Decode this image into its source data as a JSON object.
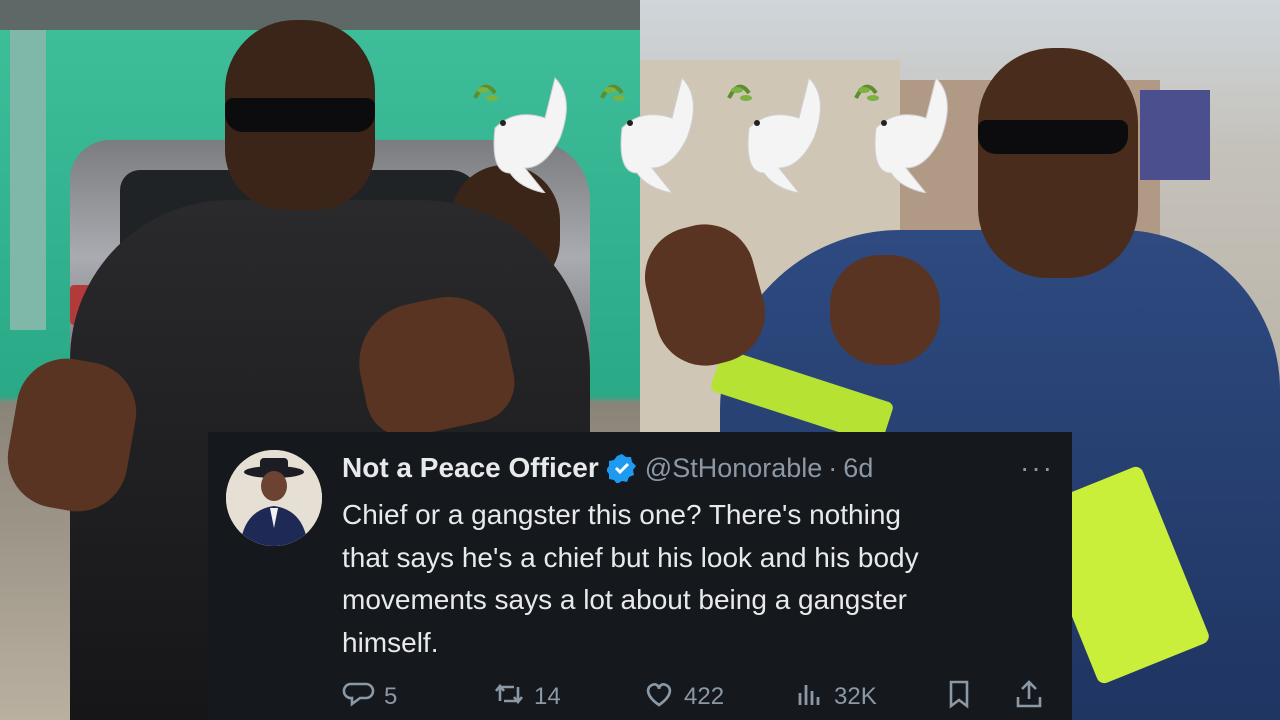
{
  "tweet": {
    "display_name": "Not a Peace Officer",
    "handle": "@StHonorable",
    "separator": "·",
    "age": "6d",
    "more": "···",
    "text": "Chief or a gangster this one? There's nothing\nthat says he's a chief but his look and his body\nmovements says a lot about being a gangster\nhimself.",
    "replies": "5",
    "retweets": "14",
    "likes": "422",
    "views": "32K"
  },
  "icons": [
    "verified-icon",
    "reply-icon",
    "retweet-icon",
    "like-icon",
    "views-icon",
    "bookmark-icon",
    "share-icon",
    "dove-icon"
  ],
  "colors": {
    "card_bg": "#15181c",
    "text": "#e7e9ea",
    "muted": "#8b98a5",
    "verified": "#1d9bf0"
  }
}
